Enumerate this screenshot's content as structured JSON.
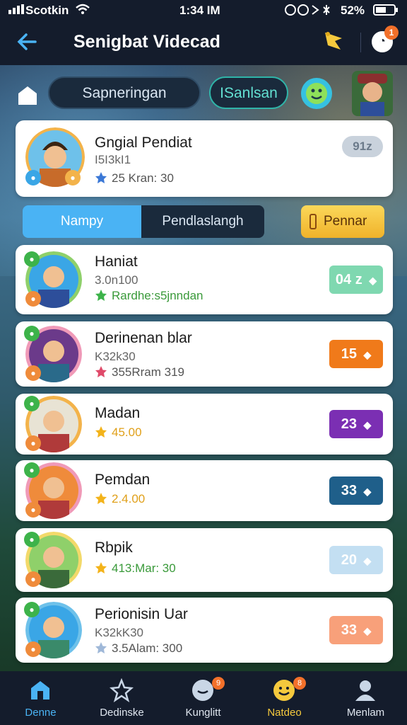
{
  "status_bar": {
    "carrier": "Scotkin",
    "time": "1:34 IM",
    "battery": "52%"
  },
  "header": {
    "title": "Senigbat Videcad",
    "notification_count": "1"
  },
  "pills": {
    "left": "Sapneringan",
    "right": "ISanlsan"
  },
  "profile": {
    "name": "Gngial Pendiat",
    "sub": "I5I3kI1",
    "meta": "25 Kran: 30",
    "score": "91z"
  },
  "segment": {
    "active": "Nampy",
    "inactive": "Pendlaslangh",
    "action": "Pennar"
  },
  "rows": [
    {
      "name": "Haniat",
      "sub": "3.0n100",
      "meta": "Rardhe:s5jnndan",
      "score": "04 z",
      "score_color": "#7fd8b0"
    },
    {
      "name": "Derinenan blar",
      "sub": "K32k30",
      "meta": "355Rram 319",
      "score": "15",
      "score_color": "#f07a1a"
    },
    {
      "name": "Madan",
      "sub": "",
      "meta": "45.00",
      "score": "23",
      "score_color": "#7b2fb3"
    },
    {
      "name": "Pemdan",
      "sub": "",
      "meta": "2.4.00",
      "score": "33",
      "score_color": "#1f5f8a"
    },
    {
      "name": "Rbpik",
      "sub": "",
      "meta": "413:Mar: 30",
      "score": "20",
      "score_color": "#c3dff2"
    },
    {
      "name": "Perionisin Uar",
      "sub": "K32kK30",
      "meta": "3.5Alam: 300",
      "score": "33",
      "score_color": "#f8a07a"
    }
  ],
  "tabs": [
    {
      "label": "Denne",
      "icon": "home-icon"
    },
    {
      "label": "Dedinske",
      "icon": "star-icon"
    },
    {
      "label": "Kunglitt",
      "icon": "chat-icon",
      "badge": "9"
    },
    {
      "label": "Natdeo",
      "icon": "smiley-icon",
      "badge": "8"
    },
    {
      "label": "Menlam",
      "icon": "profile-icon"
    }
  ],
  "colors": {
    "accent": "#4ab3f4",
    "header": "#141c2c",
    "action": "#f5c93d"
  }
}
